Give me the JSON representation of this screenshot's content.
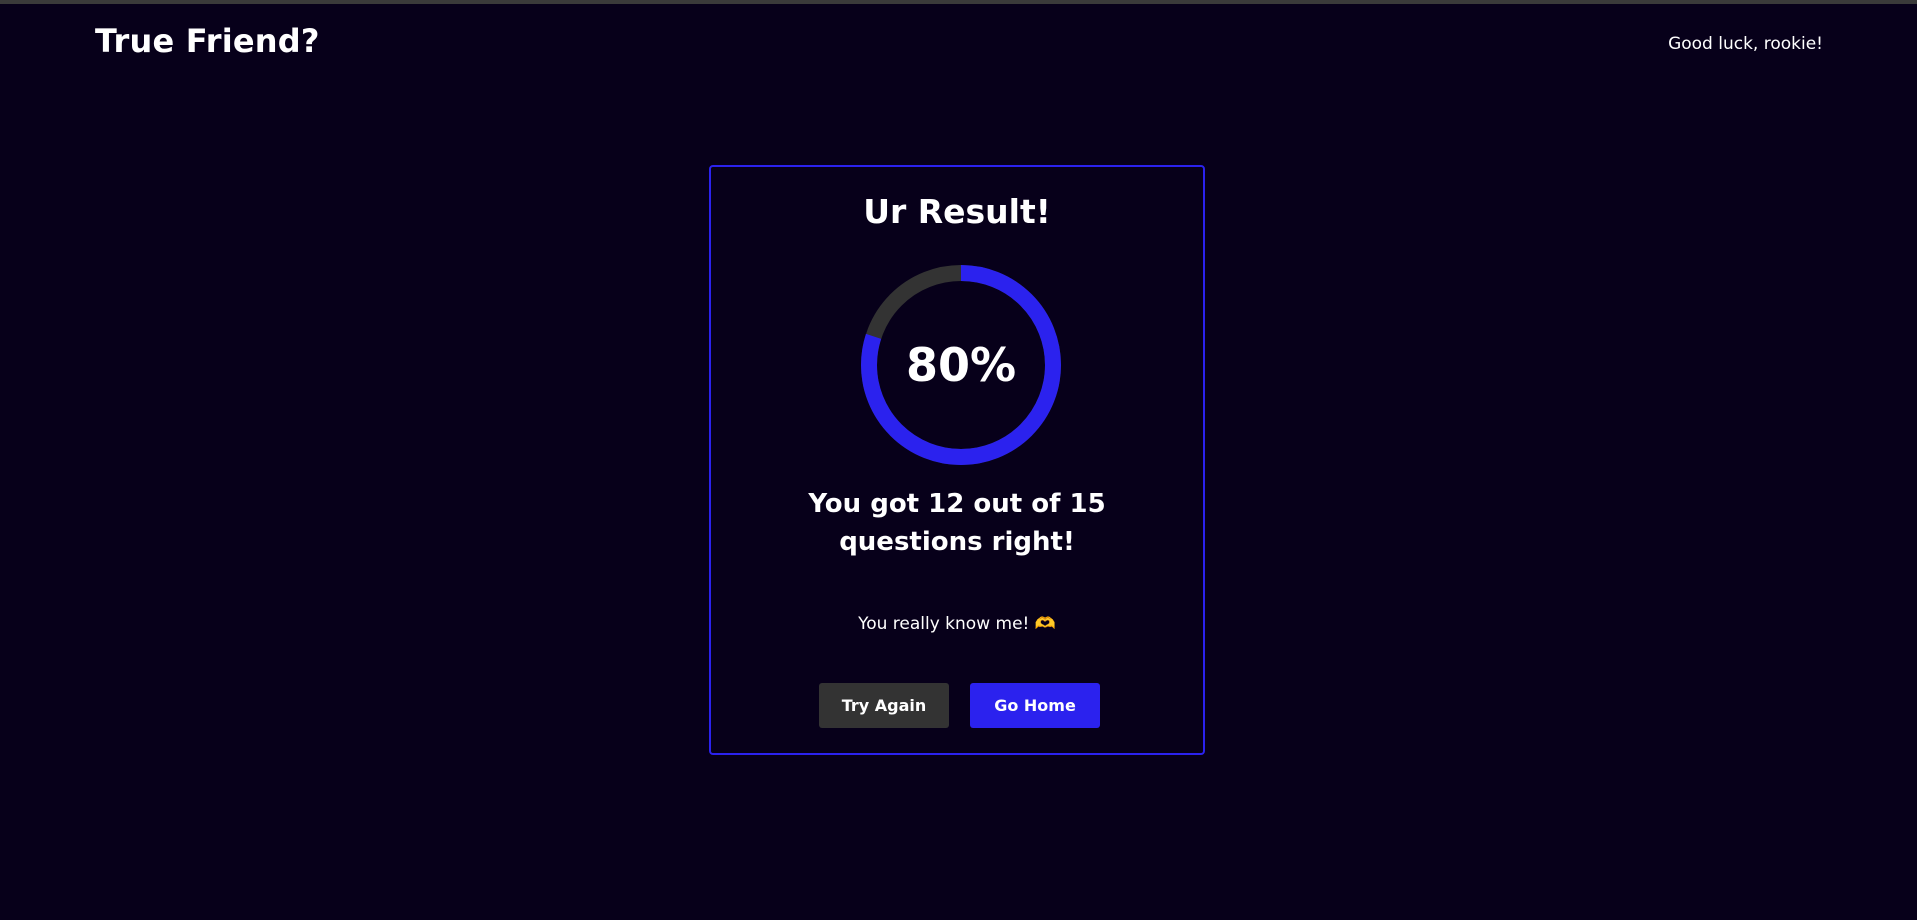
{
  "header": {
    "brand": "True Friend?",
    "tagline": "Good luck, rookie!"
  },
  "result": {
    "title": "Ur Result!",
    "percent_label": "80%",
    "progress_fraction": 0.8,
    "score_line1": "You got 12 out of 15",
    "score_line2": "questions right!",
    "message": "You really know me! 🫶",
    "try_again_label": "Try Again",
    "go_home_label": "Go Home"
  },
  "colors": {
    "background": "#07001a",
    "accent": "#2b22ee",
    "ring_track": "#333333",
    "secondary_button": "#333333"
  }
}
